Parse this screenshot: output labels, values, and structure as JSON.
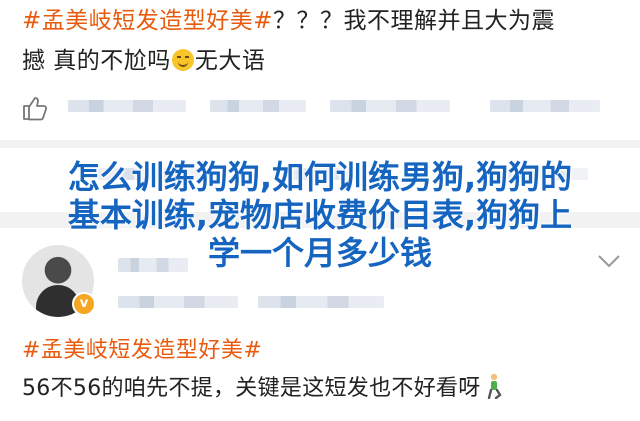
{
  "post1": {
    "hashtag": "#孟美岐短发造型好美#",
    "line1_rest": "？？？我不理解并且大为震",
    "line2_a": "撼 真的不尬吗",
    "emoji": "smiling-sweat-emoji",
    "line2_b": "无大语"
  },
  "overlay": {
    "line1": "怎么训练狗狗,如何训练男狗,狗狗的",
    "line2": "基本训练,宠物店收费价目表,狗狗上",
    "line3": "学一个月多少钱"
  },
  "icons": {
    "like": "thumbs-up-icon",
    "verified": "verified-badge-icon",
    "expand": "chevron-down-icon",
    "kneel": "kneeling-person-emoji"
  },
  "colors": {
    "hashtag": "#e95a0c",
    "overlay_text": "#1565c0",
    "badge": "#f5a623"
  },
  "comment": {
    "badge_symbol": "v",
    "hashtag": "#孟美岐短发造型好美#",
    "text": "56不56的咱先不提，关键是这短发也不好看呀"
  }
}
